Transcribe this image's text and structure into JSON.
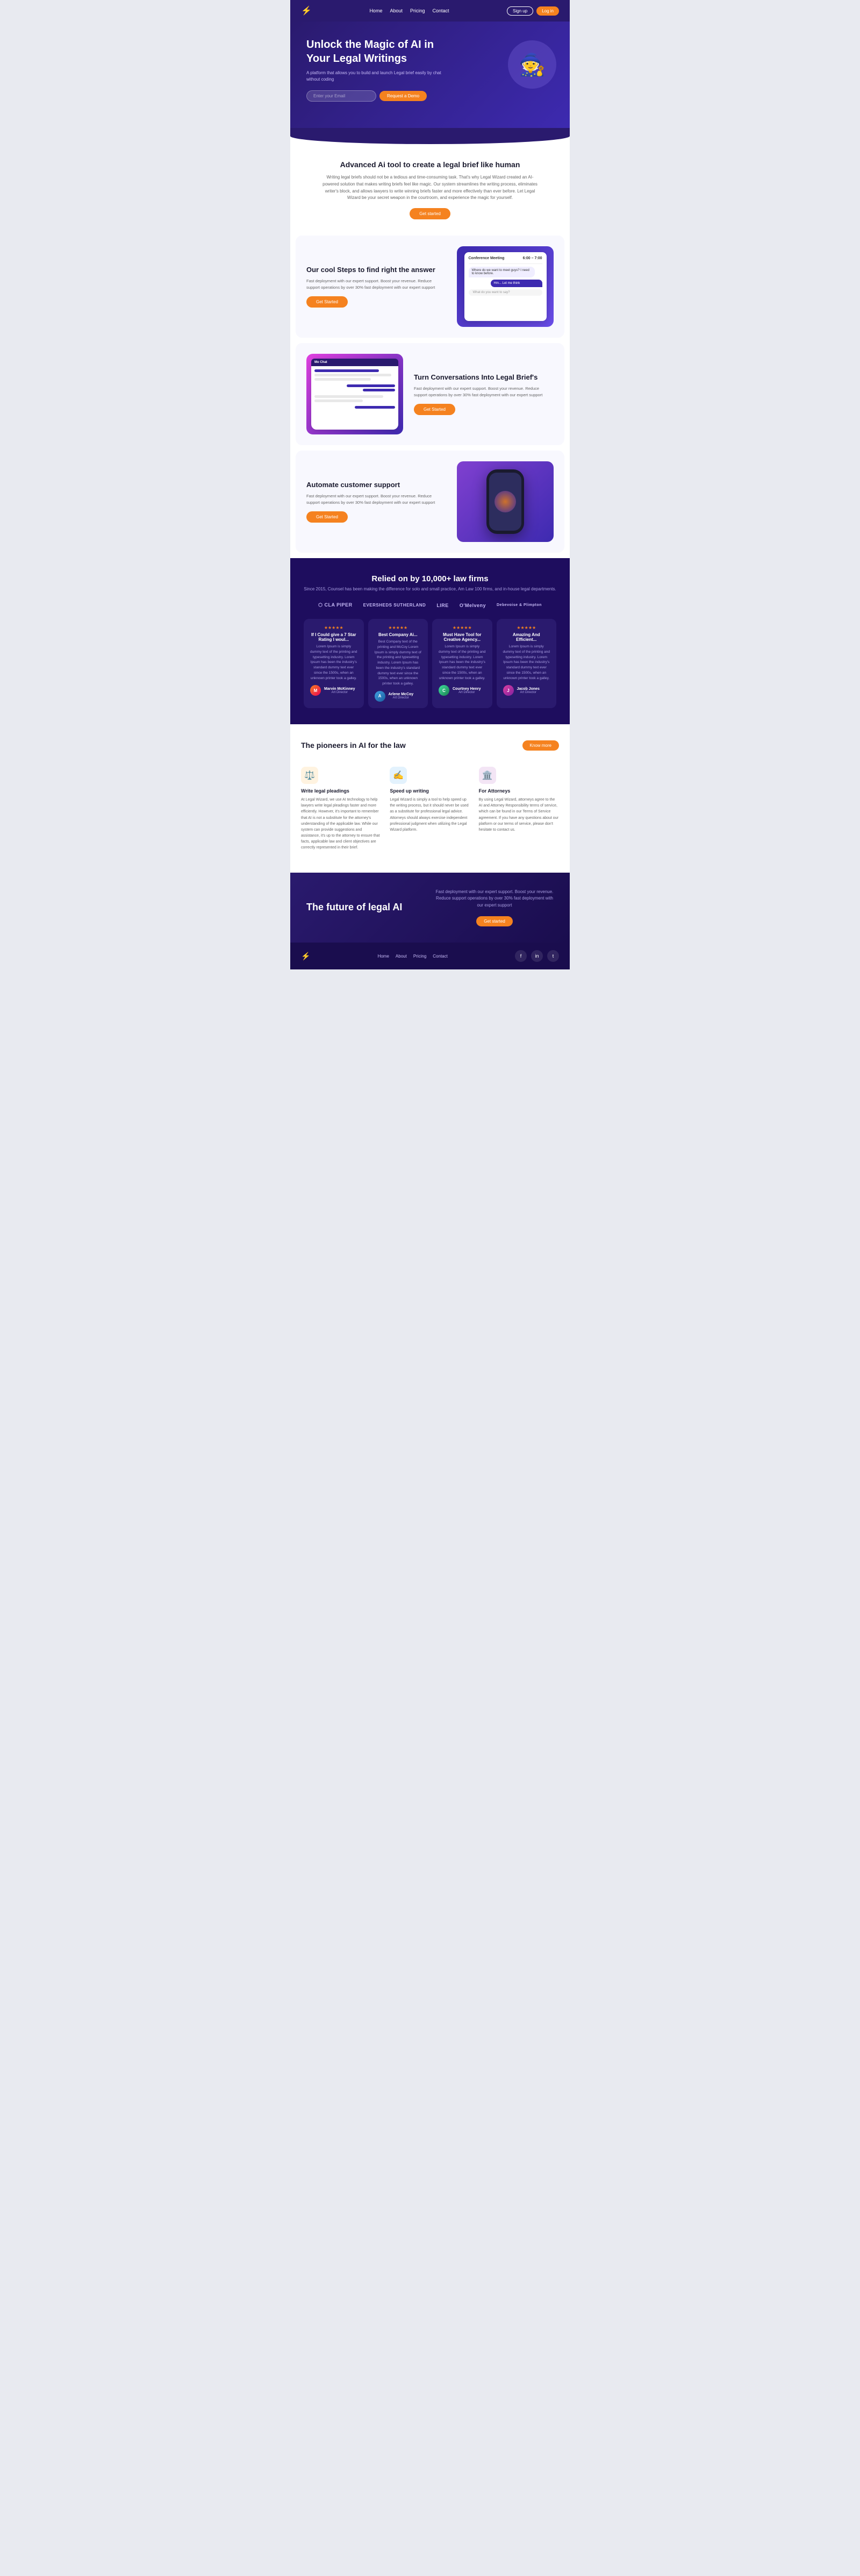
{
  "nav": {
    "links": [
      "Home",
      "About",
      "Pricing",
      "Contact"
    ],
    "logo": "⚡",
    "signup": "Sign up",
    "login": "Log in"
  },
  "hero": {
    "title": "Unlock the Magic of AI in Your Legal Writings",
    "subtitle": "A platform that allows you to build and launch Legal brief easily by chat without coding",
    "input_placeholder": "Enter your Email",
    "cta_button": "Request a Demo",
    "wizard_emoji": "🧙"
  },
  "advanced_ai": {
    "heading": "Advanced Ai tool to create a legal brief like human",
    "body": "Writing legal briefs should not be a tedious and time-consuming task. That's why Legal Wizard created an AI-powered solution that makes writing briefs feel like magic. Our system streamlines the writing process, eliminates writer's block, and allows lawyers to write winning briefs faster and more effectively than ever before. Let Legal Wizard be your secret weapon in the courtroom, and experience the magic for yourself.",
    "cta": "Get started"
  },
  "feature1": {
    "title": "Our cool Steps to find right the answer",
    "body": "Fast deployment with our expert support. Boost your revenue. Reduce support operations by over 30% fast deployment with our expert support",
    "cta": "Get Started",
    "mock_time1": "6:00",
    "mock_time2": "7:00",
    "mock_label": "Conference Meeting",
    "mock_question": "Where do we want to meet guys? I need to know before.",
    "mock_reply": "Hm... Let me think",
    "mock_prompt": "What do you want to say?"
  },
  "feature2": {
    "title": "Turn Conversations Into Legal Brief's",
    "body": "Fast deployment with our expert support. Boost your revenue. Reduce support operations by over 30% fast deployment with our expert support",
    "cta": "Get Started",
    "mock_header": "Mo Chat"
  },
  "feature3": {
    "title": "Automate customer support",
    "body": "Fast deployment with our expert support. Boost your revenue. Reduce support operations by over 30% fast deployment with our expert support",
    "cta": "Get Started"
  },
  "trusted": {
    "heading": "Relied on by 10,000+ law firms",
    "subtitle": "Since 2015, Counsel has been making the difference for solo and small practice, Am Law 100 firms, and in-house legal departments.",
    "logos": [
      {
        "name": "CLA PIPER",
        "icon": "⬡"
      },
      {
        "name": "EVERSHEDS SUTHERLAND",
        "icon": ""
      },
      {
        "name": "LIRE",
        "icon": ""
      },
      {
        "name": "O'Melveny",
        "icon": ""
      },
      {
        "name": "Debevoise & Plimpton",
        "icon": ""
      }
    ]
  },
  "testimonials": [
    {
      "stars": "★★★★★",
      "title": "If I Could give a 7 Star Rating I woul...",
      "body": "Lorem Ipsum is simply dummy text of the printing and typesetting industry. Lorem Ipsum has been the industry's standard dummy text ever since the 1500s, when an unknown printer took a galley.",
      "author": "Marvin McKinney",
      "role": "Art Director",
      "avatar": "M"
    },
    {
      "stars": "★★★★★",
      "title": "Best Company Ai...",
      "body": "Best Company text of the printing and McCoy Lorem Ipsum is simply dummy text of the printing and typesetting industry. Lorem Ipsum has been the industry's standard dummy text ever since the 1500s, when an unknown printer took a galley.",
      "author": "Arlene McCoy",
      "role": "Art Director",
      "avatar": "A"
    },
    {
      "stars": "★★★★★",
      "title": "Must Have Tool for Creative Agency...",
      "body": "Lorem Ipsum is simply dummy text of the printing and typesetting industry. Lorem Ipsum has been the industry's standard dummy text ever since the 1500s, when an unknown printer took a galley.",
      "author": "Courtney Henry",
      "role": "Art Director",
      "avatar": "C"
    },
    {
      "stars": "★★★★★",
      "title": "Amazing And Efficient...",
      "body": "Lorem Ipsum is simply dummy text of the printing and typesetting industry. Lorem Ipsum has been the industry's standard dummy text ever since the 1500s, when an unknown printer took a galley.",
      "author": "Jacob Jones",
      "role": "Art Director",
      "avatar": "J"
    }
  ],
  "pioneers": {
    "heading": "The pioneers in AI for the law",
    "know_more": "Know more",
    "features": [
      {
        "icon": "⚖️",
        "title": "Write legal pleadings",
        "body": "At Legal Wizard, we use AI technology to help lawyers write legal pleadings faster and more efficiently. However, it's important to remember that AI is not a substitute for the attorney's understanding of the applicable law. While our system can provide suggestions and assistance, it's up to the attorney to ensure that facts, applicable law and client objectives are correctly represented in their brief."
      },
      {
        "icon": "✍️",
        "title": "Speed up writing",
        "body": "Legal Wizard is simply a tool to help speed up the writing process, but it should never be used as a substitute for professional legal advice. Attorneys should always exercise independent professional judgment when utilizing the Legal Wizard platform."
      },
      {
        "icon": "🏛️",
        "title": "For Attorneys",
        "body": "By using Legal Wizard, attorneys agree to the AI and Attorney Responsibility terms of service, which can be found in our Terms of Service agreement. If you have any questions about our platform or our terms of service, please don't hesitate to contact us."
      }
    ]
  },
  "footer_cta": {
    "heading": "The future of legal AI",
    "body": "Fast deployment with our expert support. Boost your revenue. Reduce support operations by over 30% fast deployment with our expert support",
    "cta": "Get started"
  },
  "footer": {
    "logo": "⚡",
    "links": [
      "Home",
      "About",
      "Pricing",
      "Contact"
    ],
    "social": [
      "f",
      "in",
      "t"
    ]
  }
}
